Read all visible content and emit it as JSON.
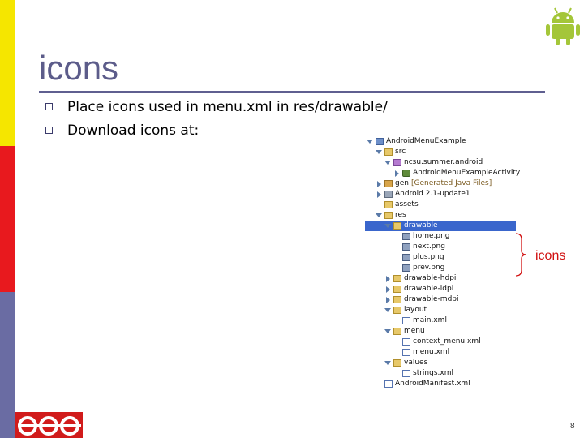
{
  "slide": {
    "title": "icons",
    "bullets": [
      "Place icons used in menu.xml in res/drawable/",
      "Download icons at:"
    ],
    "annotation": "icons",
    "page_number": "8"
  },
  "tree": [
    {
      "label": "AndroidMenuExample",
      "icon": "project-icon",
      "expand": "open",
      "depth": 0
    },
    {
      "label": "src",
      "icon": "folder-icon",
      "expand": "open",
      "depth": 1
    },
    {
      "label": "ncsu.summer.android",
      "icon": "package-icon",
      "expand": "open",
      "depth": 2
    },
    {
      "label": "AndroidMenuExampleActivity",
      "icon": "java-file-icon",
      "expand": "closed",
      "depth": 3
    },
    {
      "label": "gen",
      "note": "[Generated Java Files]",
      "icon": "gen-folder-icon",
      "expand": "closed",
      "depth": 1
    },
    {
      "label": "Android 2.1-update1",
      "icon": "library-icon",
      "expand": "closed",
      "depth": 1
    },
    {
      "label": "assets",
      "icon": "folder-icon",
      "expand": "none",
      "depth": 1
    },
    {
      "label": "res",
      "icon": "folder-icon",
      "expand": "open",
      "depth": 1
    },
    {
      "label": "drawable",
      "icon": "folder-icon",
      "expand": "open",
      "depth": 2,
      "selected": true
    },
    {
      "label": "home.png",
      "icon": "png-file-icon",
      "expand": "none",
      "depth": 3
    },
    {
      "label": "next.png",
      "icon": "png-file-icon",
      "expand": "none",
      "depth": 3
    },
    {
      "label": "plus.png",
      "icon": "png-file-icon",
      "expand": "none",
      "depth": 3
    },
    {
      "label": "prev.png",
      "icon": "png-file-icon",
      "expand": "none",
      "depth": 3
    },
    {
      "label": "drawable-hdpi",
      "icon": "folder-icon",
      "expand": "closed",
      "depth": 2
    },
    {
      "label": "drawable-ldpi",
      "icon": "folder-icon",
      "expand": "closed",
      "depth": 2
    },
    {
      "label": "drawable-mdpi",
      "icon": "folder-icon",
      "expand": "closed",
      "depth": 2
    },
    {
      "label": "layout",
      "icon": "folder-icon",
      "expand": "open",
      "depth": 2
    },
    {
      "label": "main.xml",
      "icon": "xml-file-icon",
      "expand": "none",
      "depth": 3
    },
    {
      "label": "menu",
      "icon": "folder-icon",
      "expand": "open",
      "depth": 2
    },
    {
      "label": "context_menu.xml",
      "icon": "xml-file-icon",
      "expand": "none",
      "depth": 3
    },
    {
      "label": "menu.xml",
      "icon": "xml-file-icon",
      "expand": "none",
      "depth": 3
    },
    {
      "label": "values",
      "icon": "folder-icon",
      "expand": "open",
      "depth": 2
    },
    {
      "label": "strings.xml",
      "icon": "xml-file-icon",
      "expand": "none",
      "depth": 3
    },
    {
      "label": "AndroidManifest.xml",
      "icon": "xml-file-icon",
      "expand": "none",
      "depth": 1
    }
  ],
  "colors": {
    "sidebar_yellow": "#f5e600",
    "sidebar_red": "#e8191e",
    "sidebar_blue": "#6a6ca3",
    "title": "#5c5c8a",
    "selection": "#3a66cc",
    "annotation": "#d11010",
    "android_green": "#a4c639"
  }
}
